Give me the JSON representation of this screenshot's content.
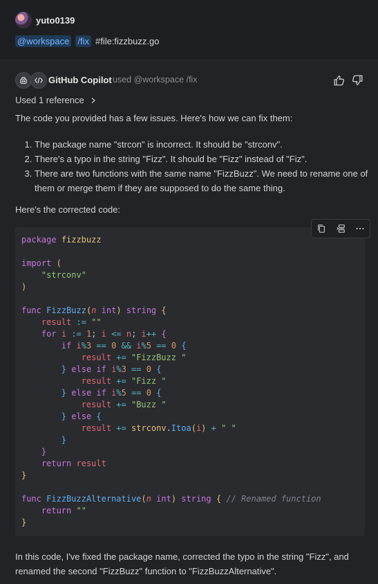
{
  "user": {
    "name": "yuto0139",
    "chip_workspace": "@workspace",
    "chip_fix": "/fix",
    "file_ref": "#file:fizzbuzz.go"
  },
  "response": {
    "agent_name": "GitHub Copilot",
    "used_text": "used @workspace /fix",
    "used_reference": "Used 1 reference",
    "intro": "The code you provided has a few issues. Here's how we can fix them:",
    "issues": [
      "The package name \"strcon\" is incorrect. It should be \"strconv\".",
      "There's a typo in the string \"Fizz\". It should be \"Fizz\" instead of \"Fiz\".",
      "There are two functions with the same name \"FizzBuzz\". We need to rename one of them or merge them if they are supposed to do the same thing."
    ],
    "corrected_label": "Here's the corrected code:",
    "summary": "In this code, I've fixed the package name, corrected the typo in the string \"Fizz\", and renamed the second \"FizzBuzz\" function to \"FizzBuzzAlternative\"."
  },
  "code": {
    "language": "go",
    "lines": [
      "package fizzbuzz",
      "",
      "import (",
      "    \"strconv\"",
      ")",
      "",
      "func FizzBuzz(n int) string {",
      "    result := \"\"",
      "    for i := 1; i <= n; i++ {",
      "        if i%3 == 0 && i%5 == 0 {",
      "            result += \"FizzBuzz \"",
      "        } else if i%3 == 0 {",
      "            result += \"Fizz \"",
      "        } else if i%5 == 0 {",
      "            result += \"Buzz \"",
      "        } else {",
      "            result += strconv.Itoa(i) + \" \"",
      "        }",
      "    }",
      "    return result",
      "}",
      "",
      "func FizzBuzzAlternative(n int) string { // Renamed function",
      "    return \"\"",
      "}"
    ]
  },
  "icons": {
    "avatar": "user-avatar",
    "copilot": "copilot-icon",
    "code": "code-brackets-icon",
    "chevron": "chevron-right-icon",
    "thumbs_up": "thumbs-up-icon",
    "thumbs_down": "thumbs-down-icon",
    "copy": "copy-icon",
    "insert": "insert-at-cursor-icon",
    "more": "more-icon"
  },
  "colors": {
    "background": "#1e1f22",
    "response_bg": "#222327",
    "code_bg": "#2a2b2f",
    "chip_bg": "#1f3b58",
    "chip_text": "#7cb8ff",
    "keyword": "#c678dd",
    "string": "#98c379",
    "function": "#61afef"
  }
}
